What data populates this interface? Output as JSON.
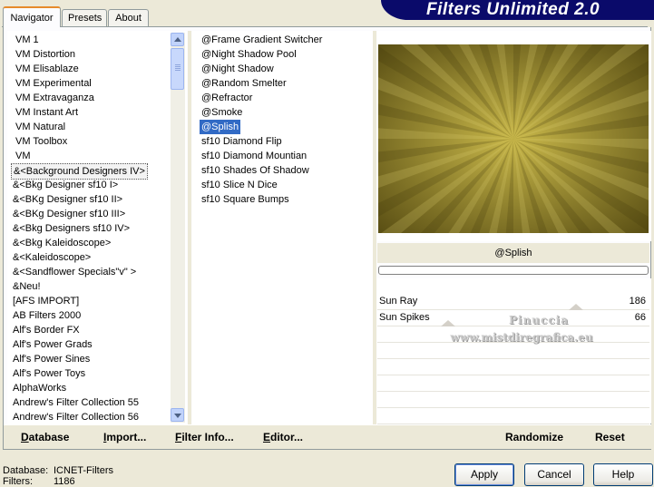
{
  "app_title": "Filters Unlimited 2.0",
  "tabs": [
    {
      "label": "Navigator",
      "active": true
    },
    {
      "label": "Presets",
      "active": false
    },
    {
      "label": "About",
      "active": false
    }
  ],
  "categories": [
    "VM 1",
    "VM Distortion",
    "VM Elisablaze",
    "VM Experimental",
    "VM Extravaganza",
    "VM Instant Art",
    "VM Natural",
    "VM Toolbox",
    "VM",
    "&<Background Designers IV>",
    "&<Bkg Designer sf10 I>",
    "&<BKg Designer sf10 II>",
    "&<BKg Designer sf10 III>",
    "&<Bkg Designers sf10 IV>",
    "&<Bkg Kaleidoscope>",
    "&<Kaleidoscope>",
    "&<Sandflower Specials\"v\" >",
    "&Neu!",
    "[AFS IMPORT]",
    "AB Filters 2000",
    "Alf's Border FX",
    "Alf's Power Grads",
    "Alf's Power Sines",
    "Alf's Power Toys",
    "AlphaWorks",
    "Andrew's Filter Collection 55",
    "Andrew's Filter Collection 56"
  ],
  "selected_category_index": 9,
  "filters": [
    "@Frame Gradient Switcher",
    "@Night Shadow Pool",
    "@Night Shadow",
    "@Random Smelter",
    "@Refractor",
    "@Smoke",
    "@Splish",
    "sf10 Diamond Flip",
    "sf10 Diamond Mountian",
    "sf10 Shades Of Shadow",
    "sf10 Slice N Dice",
    "sf10 Square Bumps"
  ],
  "selected_filter_index": 6,
  "selected_filter_name": "@Splish",
  "params": [
    {
      "label": "Sun Ray",
      "value": "186",
      "fraction": 0.73
    },
    {
      "label": "Sun Spikes",
      "value": "66",
      "fraction": 0.26
    }
  ],
  "watermark": {
    "line1": "Pinuccia",
    "line2": "www.mistdiregrafica.eu"
  },
  "toolbar": {
    "database": "Database",
    "import": "Import...",
    "filter_info": "Filter Info...",
    "editor": "Editor...",
    "randomize": "Randomize",
    "reset": "Reset"
  },
  "status": {
    "database_label": "Database:",
    "database_value": "ICNET-Filters",
    "filters_label": "Filters:",
    "filters_value": "1186"
  },
  "buttons": {
    "apply": "Apply",
    "cancel": "Cancel",
    "help": "Help"
  },
  "colors": {
    "preview_light": "#c9b84a",
    "preview_dark": "#5a4f14",
    "selection_blue": "#316ac5",
    "banner_blue": "#0a0a6a"
  }
}
